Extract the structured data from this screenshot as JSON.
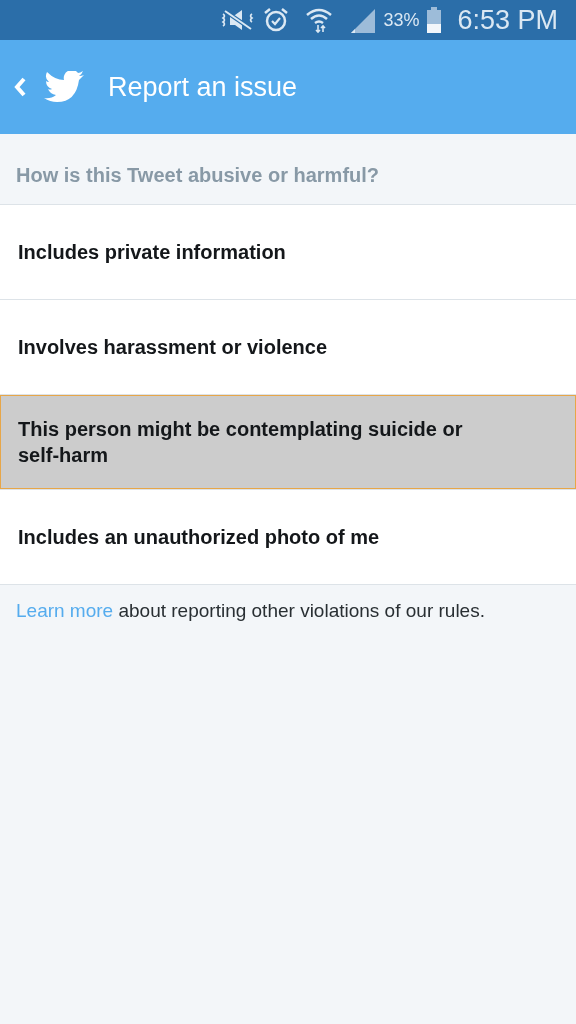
{
  "status_bar": {
    "battery_percent": "33%",
    "time": "6:53 PM"
  },
  "header": {
    "title": "Report an issue"
  },
  "question": "How is this Tweet abusive or harmful?",
  "options": [
    {
      "label": "Includes private information",
      "selected": false
    },
    {
      "label": "Involves harassment or violence",
      "selected": false
    },
    {
      "label": "This person might be contemplating suicide or self-harm",
      "selected": true
    },
    {
      "label": "Includes an unauthorized photo of me",
      "selected": false
    }
  ],
  "footer": {
    "link": "Learn more",
    "text": "about reporting other violations of our rules."
  }
}
